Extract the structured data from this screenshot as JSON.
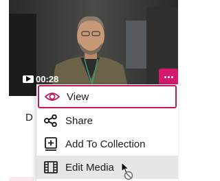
{
  "video": {
    "duration": "00:28",
    "play_icon": "play-icon",
    "more_icon": "more-dots-icon",
    "accent_color": "#d5196f"
  },
  "background_card": {
    "partial_letter": "D"
  },
  "context_menu": {
    "items": [
      {
        "label": "View",
        "icon": "eye-icon",
        "state": "focused"
      },
      {
        "label": "Share",
        "icon": "share-icon",
        "state": "normal"
      },
      {
        "label": "Add To Collection",
        "icon": "add-to-collection-icon",
        "state": "normal"
      },
      {
        "label": "Edit Media",
        "icon": "film-edit-icon",
        "state": "hovered"
      }
    ],
    "focus_color": "#c0185f"
  },
  "pointer": {
    "icon": "cursor-busy-icon"
  }
}
